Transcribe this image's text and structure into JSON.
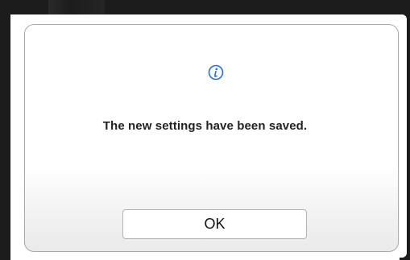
{
  "dialog": {
    "icon": "info-icon",
    "message": "The new settings have been saved.",
    "ok_label": "OK"
  },
  "colors": {
    "icon_blue": "#2f6fc6",
    "text": "#222222",
    "border": "#a9a9a9"
  }
}
